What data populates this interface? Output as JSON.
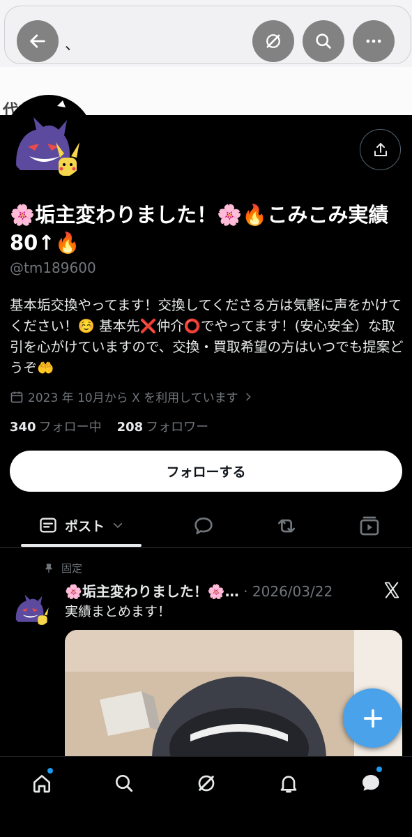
{
  "banner": {
    "top_text": "、",
    "partial_text": "代名"
  },
  "nav": {
    "back": "arrow-left-icon",
    "grok": "grok-icon",
    "search": "search-icon",
    "more": "more-icon"
  },
  "profile": {
    "display_name": "🌸垢主変わりました！🌸🔥こみこみ実績80↑🔥",
    "handle": "@tm189600",
    "bio": "基本垢交換やってます！交換してくださる方は気軽に声をかけてください！☺️ 基本先❌仲介⭕️でやってます！(安心安全）な取引を心がけていますので、交換・買取希望の方はいつでも提案どうぞ🤲",
    "joined": "2023 年 10月から X を利用しています",
    "following_count": "340",
    "following_label": "フォロー中",
    "followers_count": "208",
    "followers_label": "フォロワー",
    "follow_button": "フォローする"
  },
  "tabs": {
    "posts_label": "ポスト"
  },
  "pinned_post": {
    "pinned_label": "固定",
    "author": "🌸垢主変わりました！🌸…",
    "separator": "·",
    "date": "2026/03/22",
    "text": "実績まとめます！"
  },
  "colors": {
    "accent": "#1d9bf0",
    "fab": "#4aa3ea",
    "background": "#000000",
    "muted": "#71767b"
  }
}
